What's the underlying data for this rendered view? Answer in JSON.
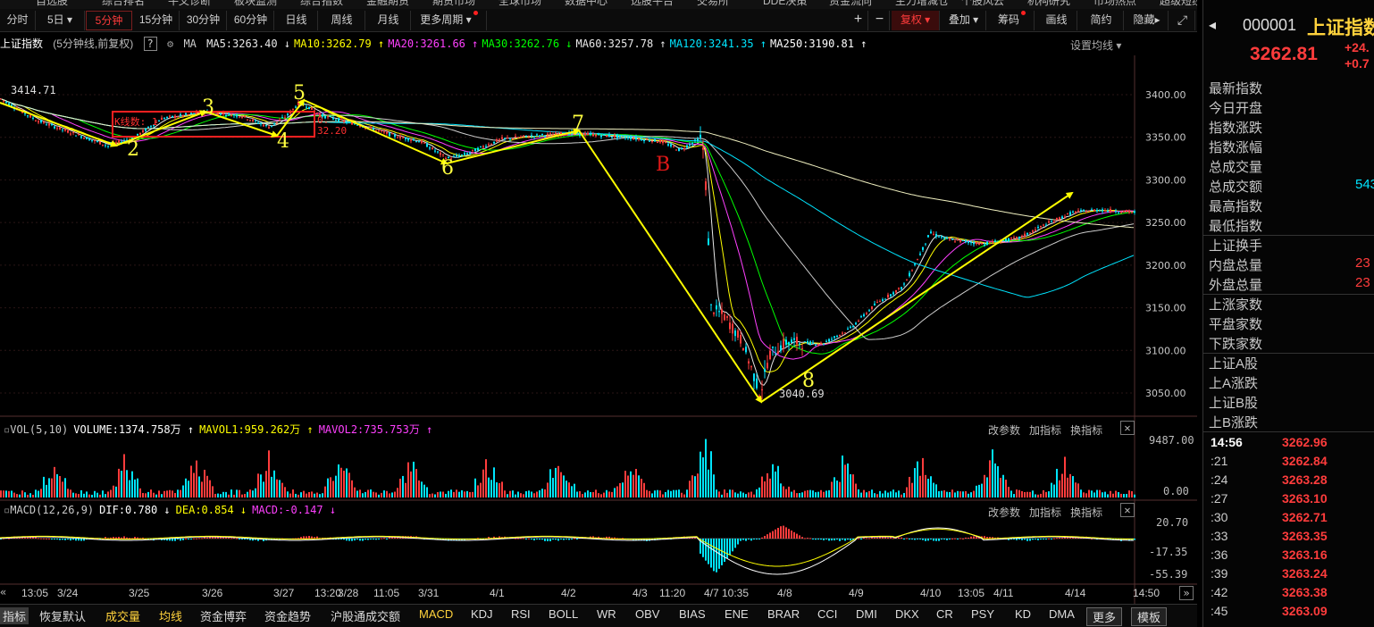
{
  "menu": [
    "自选股",
    "综合排名",
    "牛叉诊断",
    "板块监测",
    "综合指数",
    "金融期货",
    "期货市场",
    "全球市场",
    "数据中心",
    "选股平台",
    "交易所",
    "DDE决策",
    "资金流向",
    "主力增减仓",
    "个股风云",
    "机构研究",
    "市场热点",
    "超级短线"
  ],
  "toolbar": {
    "periods": [
      "分时",
      "5日",
      "5分钟",
      "15分钟",
      "30分钟",
      "60分钟",
      "日线",
      "周线",
      "月线",
      "更多周期"
    ],
    "active_period": "5分钟",
    "right_buttons": [
      "复权",
      "叠加",
      "筹码",
      "画线",
      "简约",
      "隐藏"
    ]
  },
  "ma_bar": {
    "title": "上证指数",
    "subtitle": "(5分钟线,前复权)",
    "ma_label": "MA",
    "items": [
      {
        "label": "MA5:3263.40",
        "color": "#e8e8e8",
        "arrow": "↓"
      },
      {
        "label": "MA10:3262.79",
        "color": "#ffff00",
        "arrow": "↑"
      },
      {
        "label": "MA20:3261.66",
        "color": "#ff40ff",
        "arrow": "↑"
      },
      {
        "label": "MA30:3262.76",
        "color": "#00ff00",
        "arrow": "↓"
      },
      {
        "label": "MA60:3257.78",
        "color": "#e8e8e8",
        "arrow": "↑"
      },
      {
        "label": "MA120:3241.35",
        "color": "#00e5ff",
        "arrow": "↑"
      },
      {
        "label": "MA250:3190.81",
        "color": "#ffffff",
        "arrow": "↑"
      }
    ],
    "settings": "设置均线"
  },
  "price_axis": [
    "3400.00",
    "3350.00",
    "3300.00",
    "3250.00",
    "3200.00",
    "3150.00",
    "3100.00",
    "3050.00"
  ],
  "annotations": {
    "high_label": "3414.71",
    "low_label": "3040.69",
    "kline_box": "K线数: 1",
    "box_vals": [
      "0.",
      "32.20"
    ],
    "numbers": [
      "2",
      "3",
      "4",
      "5",
      "6",
      "7",
      "8"
    ],
    "letter_b": "B"
  },
  "vol_panel": {
    "header": [
      {
        "text": "VOL(5,10)",
        "color": "#c8c8c8"
      },
      {
        "text": "VOLUME:1374.758万 ↑",
        "color": "#ffffff"
      },
      {
        "text": "MAVOL1:959.262万 ↑",
        "color": "#ffff00"
      },
      {
        "text": "MAVOL2:735.753万 ↑",
        "color": "#ff40ff"
      }
    ],
    "axis": [
      "9487.00",
      "0.00"
    ],
    "actions": [
      "改参数",
      "加指标",
      "换指标"
    ]
  },
  "macd_panel": {
    "header": [
      {
        "text": "MACD(12,26,9)",
        "color": "#c8c8c8"
      },
      {
        "text": "DIF:0.780 ↓",
        "color": "#ffffff"
      },
      {
        "text": "DEA:0.854 ↓",
        "color": "#ffff00"
      },
      {
        "text": "MACD:-0.147 ↓",
        "color": "#ff40ff"
      }
    ],
    "axis": [
      "20.70",
      "-17.35",
      "-55.39"
    ],
    "actions": [
      "改参数",
      "加指标",
      "换指标"
    ]
  },
  "x_axis": [
    "13:05",
    "3/24",
    "3/25",
    "3/26",
    "3/27",
    "13:20",
    "3/28",
    "11:05",
    "3/31",
    "4/1",
    "4/2",
    "4/3",
    "11:20",
    "4/7",
    "10:35",
    "4/8",
    "4/9",
    "4/10",
    "13:05",
    "4/11",
    "4/14",
    "14:50"
  ],
  "bottom_tabs": [
    "指标",
    "恢复默认",
    "成交量",
    "均线",
    "资金博弈",
    "资金趋势",
    "沪股通成交额",
    "MACD",
    "KDJ",
    "RSI",
    "BOLL",
    "WR",
    "OBV",
    "BIAS",
    "ENE",
    "BRAR",
    "CCI",
    "DMI",
    "DKX",
    "CR",
    "PSY",
    "KD",
    "DMA",
    "更多",
    "模板"
  ],
  "sidebar": {
    "code": "000001",
    "name": "上证指数",
    "price": "3262.81",
    "change": "+24.",
    "change_pct": "+0.7",
    "fields": [
      "最新指数",
      "今日开盘",
      "指数涨跌",
      "指数涨幅",
      "总成交量",
      "总成交额",
      "最高指数",
      "最低指数",
      "上证换手",
      "内盘总量",
      "外盘总量",
      "上涨家数",
      "平盘家数",
      "下跌家数",
      "上证A股",
      "上A涨跌",
      "上证B股",
      "上B涨跌"
    ],
    "field_values": {
      "总成交额": "543",
      "内盘总量": "23",
      "外盘总量": "23"
    },
    "ticks": [
      {
        "time": "14:56",
        "price": "3262.96"
      },
      {
        "time": ":21",
        "price": "3262.84"
      },
      {
        "time": ":24",
        "price": "3263.28"
      },
      {
        "time": ":27",
        "price": "3263.10"
      },
      {
        "time": ":30",
        "price": "3262.71"
      },
      {
        "time": ":33",
        "price": "3263.35"
      },
      {
        "time": ":36",
        "price": "3263.16"
      },
      {
        "time": ":39",
        "price": "3263.24"
      },
      {
        "time": ":42",
        "price": "3263.38"
      },
      {
        "time": ":45",
        "price": "3263.09"
      }
    ]
  },
  "colors": {
    "up": "#ff3c3c",
    "down": "#00e5ff",
    "arrow": "#ffff00",
    "background": "#000000"
  }
}
